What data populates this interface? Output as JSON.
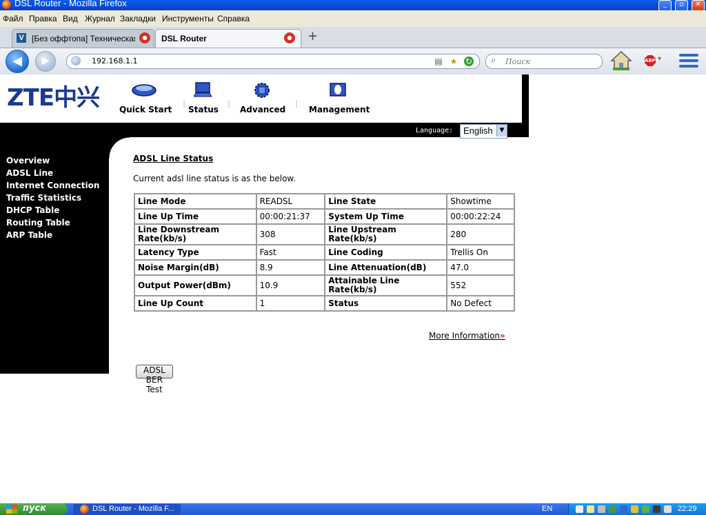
{
  "window": {
    "title": "DSL Router - Mozilla Firefox"
  },
  "menubar": {
    "items": [
      "Файл",
      "Правка",
      "Вид",
      "Журнал",
      "Закладки",
      "Инструменты",
      "Справка"
    ]
  },
  "tabs": [
    {
      "label": "[Без оффтопа] Техническая...",
      "favicon": "V",
      "active": false
    },
    {
      "label": "DSL Router",
      "active": true
    }
  ],
  "newtab_label": "+",
  "address": {
    "url": "192.168.1.1"
  },
  "search": {
    "placeholder": "Поиск"
  },
  "router": {
    "brand": "ZTE中兴",
    "nav": [
      "Quick Start",
      "Status",
      "Advanced",
      "Management"
    ],
    "language_label": "Language:",
    "language_value": "English",
    "sidebar": [
      "Overview",
      "ADSL Line",
      "Internet Connection",
      "Traffic Statistics",
      "DHCP Table",
      "Routing Table",
      "ARP Table"
    ],
    "section_title": "ADSL Line Status",
    "section_desc": "Current adsl line status is as the below.",
    "rows": [
      {
        "l1": "Line Mode",
        "v1": "READSL",
        "l2": "Line State",
        "v2": "Showtime"
      },
      {
        "l1": "Line Up Time",
        "v1": "00:00:21:37",
        "l2": "System Up Time",
        "v2": "00:00:22:24"
      },
      {
        "l1": "Line Downstream Rate(kb/s)",
        "v1": "308",
        "l2": "Line Upstream Rate(kb/s)",
        "v2": "280"
      },
      {
        "l1": "Latency Type",
        "v1": "Fast",
        "l2": "Line Coding",
        "v2": "Trellis On"
      },
      {
        "l1": "Noise Margin(dB)",
        "v1": "8.9",
        "l2": "Line Attenuation(dB)",
        "v2": "47.0"
      },
      {
        "l1": "Output Power(dBm)",
        "v1": "10.9",
        "l2": "Attainable Line Rate(kb/s)",
        "v2": "552"
      },
      {
        "l1": "Line Up Count",
        "v1": "1",
        "l2": "Status",
        "v2": "No Defect"
      }
    ],
    "more_info": "More Information",
    "ber_button": "ADSL BER Test"
  },
  "taskbar": {
    "start_label": "пуск",
    "task_label": "DSL Router - Mozilla F...",
    "language": "EN",
    "clock": "22:29"
  },
  "colors": {
    "brand_blue": "#1a3a8f",
    "header_black": "#000000",
    "taskbar_blue": "#235ad8"
  }
}
